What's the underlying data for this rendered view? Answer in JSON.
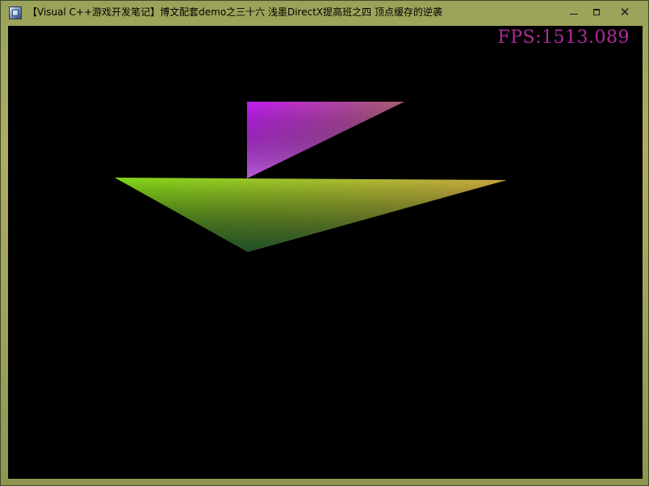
{
  "window": {
    "title": "【Visual C++游戏开发笔记】博文配套demo之三十六 浅墨DirectX提高班之四 顶点缓存的逆袭",
    "icon": "app-window-icon",
    "controls": {
      "minimize": "minimize-icon",
      "maximize": "maximize-icon",
      "close": "close-icon"
    }
  },
  "render": {
    "fps_text": "FPS:1513.089",
    "fps_color": "#b02b9a",
    "background_color": "#000000",
    "triangles": [
      {
        "name": "upper-triangle",
        "vertex_colors": [
          "#c21ff0",
          "#a8606e",
          "#b86cd8"
        ]
      },
      {
        "name": "lower-triangle",
        "vertex_colors": [
          "#86e01a",
          "#c2a040",
          "#1a4a2a"
        ]
      }
    ]
  }
}
